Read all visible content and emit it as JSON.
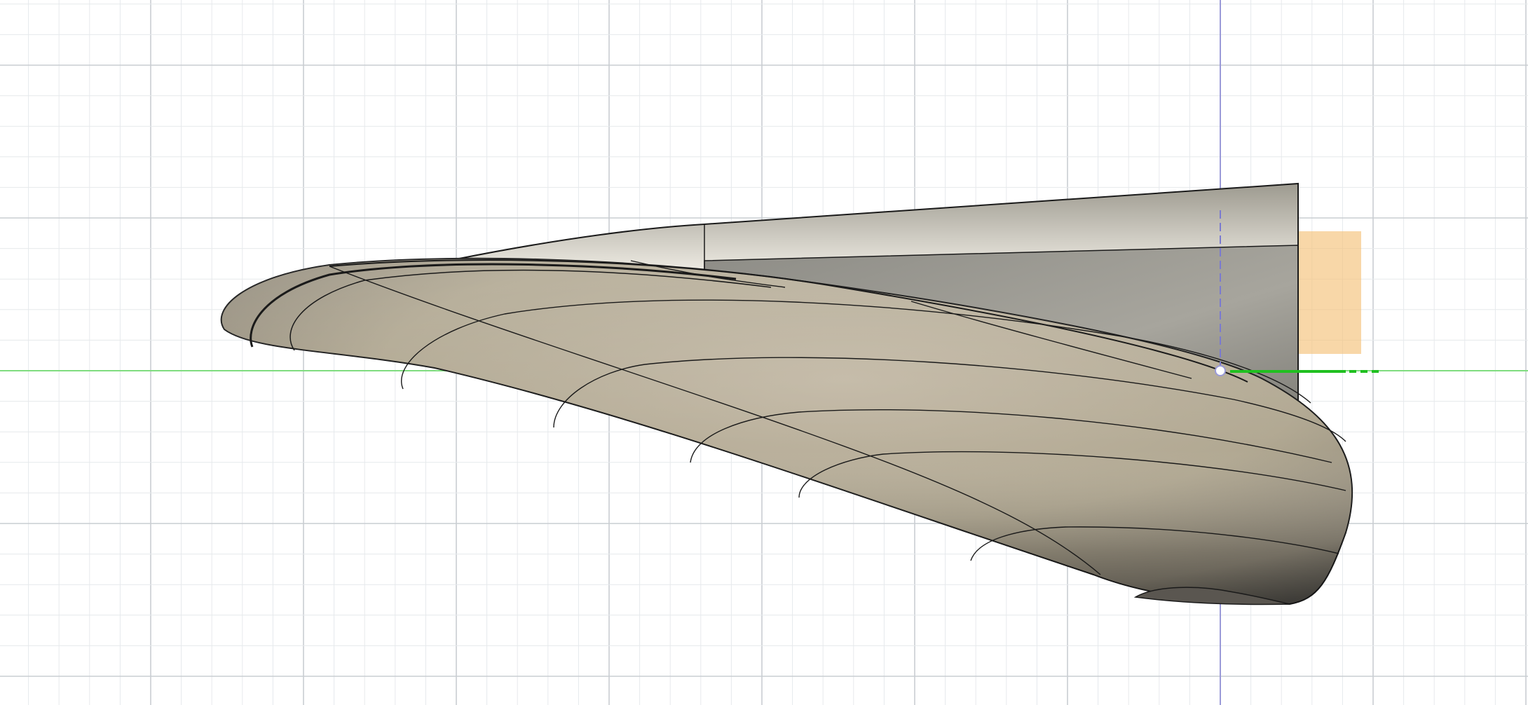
{
  "viewport": {
    "type": "cad-3d-canvas",
    "background_color": "#ffffff",
    "grid": {
      "visible": true,
      "minor_line_color": "#e6e9ec",
      "major_line_color": "#c9cdd2"
    },
    "axes": {
      "x_axis_color": "#7fdc7f",
      "x_axis_highlight_color": "#20c020",
      "y_axis_color": "#9a9ad8"
    },
    "model": {
      "body_name_icon": "lofted-surface-body",
      "base_color": "#b3a993",
      "edge_color": "#1a1a1a"
    },
    "selection_box": {
      "color": "#f5c27a"
    }
  }
}
